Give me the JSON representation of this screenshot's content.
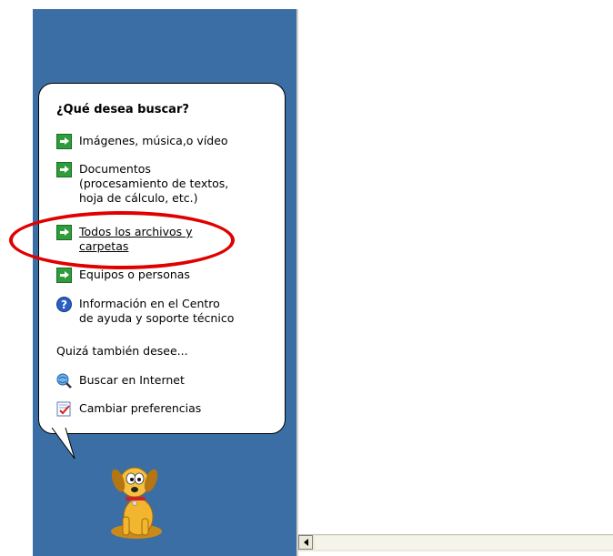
{
  "panel": {
    "heading": "¿Qué desea buscar?",
    "options": [
      {
        "label": "Imágenes, música,o vídeo",
        "icon": "green-arrow-icon"
      },
      {
        "label": "Documentos\n(procesamiento de textos,\nhoja de cálculo, etc.)",
        "icon": "green-arrow-icon"
      },
      {
        "label": "Todos los archivos y\ncarpetas",
        "icon": "green-arrow-icon"
      },
      {
        "label": "Equipos o personas",
        "icon": "green-arrow-icon"
      },
      {
        "label": "Información en el Centro\nde ayuda y soporte técnico",
        "icon": "help-icon"
      }
    ],
    "also_heading": "Quizá también desee...",
    "also_options": [
      {
        "label": "Buscar en Internet",
        "icon": "internet-search-icon"
      },
      {
        "label": "Cambiar preferencias",
        "icon": "preferences-checklist-icon"
      }
    ]
  },
  "colors": {
    "pane_blue": "#3a6ea5",
    "highlight_ring": "#e00000",
    "arrow_green": "#2e9d3a"
  }
}
